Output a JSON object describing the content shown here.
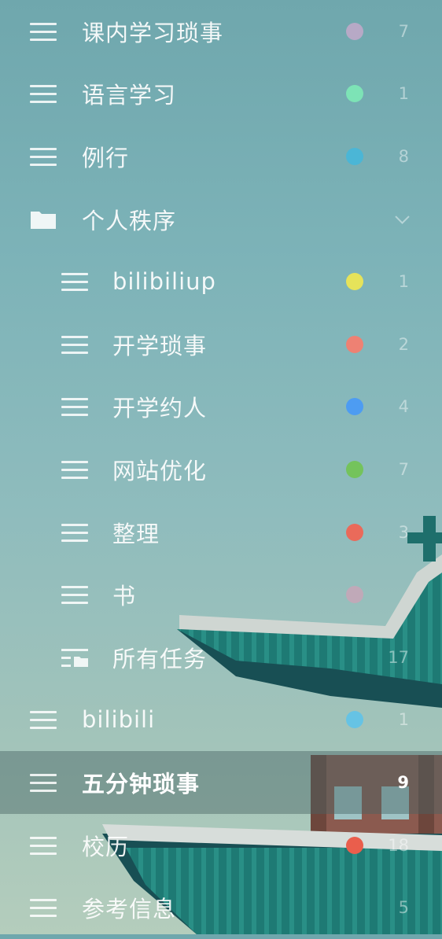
{
  "lists": [
    {
      "icon": "list-icon",
      "label": "课内学习琐事",
      "color": "#b7a9c6",
      "count": "7",
      "level": "top"
    },
    {
      "icon": "list-icon",
      "label": "语言学习",
      "color": "#7de3b6",
      "count": "1",
      "level": "top"
    },
    {
      "icon": "list-icon",
      "label": "例行",
      "color": "#4bb6d6",
      "count": "8",
      "level": "top"
    },
    {
      "icon": "folder-icon",
      "label": "个人秩序",
      "color": "",
      "count": "",
      "level": "top",
      "expanded": true
    },
    {
      "icon": "list-icon",
      "label": "bilibiliup",
      "color": "#e6e35a",
      "count": "1",
      "level": "child"
    },
    {
      "icon": "list-icon",
      "label": "开学琐事",
      "color": "#ee8173",
      "count": "2",
      "level": "child"
    },
    {
      "icon": "list-icon",
      "label": "开学约人",
      "color": "#4d9cf2",
      "count": "4",
      "level": "child"
    },
    {
      "icon": "list-icon",
      "label": "网站优化",
      "color": "#74c35c",
      "count": "7",
      "level": "child"
    },
    {
      "icon": "list-icon",
      "label": "整理",
      "color": "#ea6a5a",
      "count": "3",
      "level": "child"
    },
    {
      "icon": "list-icon",
      "label": "书",
      "color": "#c0a9b8",
      "count": "",
      "level": "child"
    },
    {
      "icon": "all-tasks-icon",
      "label": "所有任务",
      "color": "",
      "count": "17",
      "level": "child"
    },
    {
      "icon": "list-icon",
      "label": "bilibili",
      "color": "#66c3e4",
      "count": "1",
      "level": "top"
    },
    {
      "icon": "list-icon",
      "label": "五分钟琐事",
      "color": "",
      "count": "9",
      "level": "top",
      "selected": true
    },
    {
      "icon": "list-icon",
      "label": "校历",
      "color": "#ea5e4c",
      "count": "18",
      "level": "top"
    },
    {
      "icon": "list-icon",
      "label": "参考信息",
      "color": "",
      "count": "5",
      "level": "top"
    }
  ]
}
